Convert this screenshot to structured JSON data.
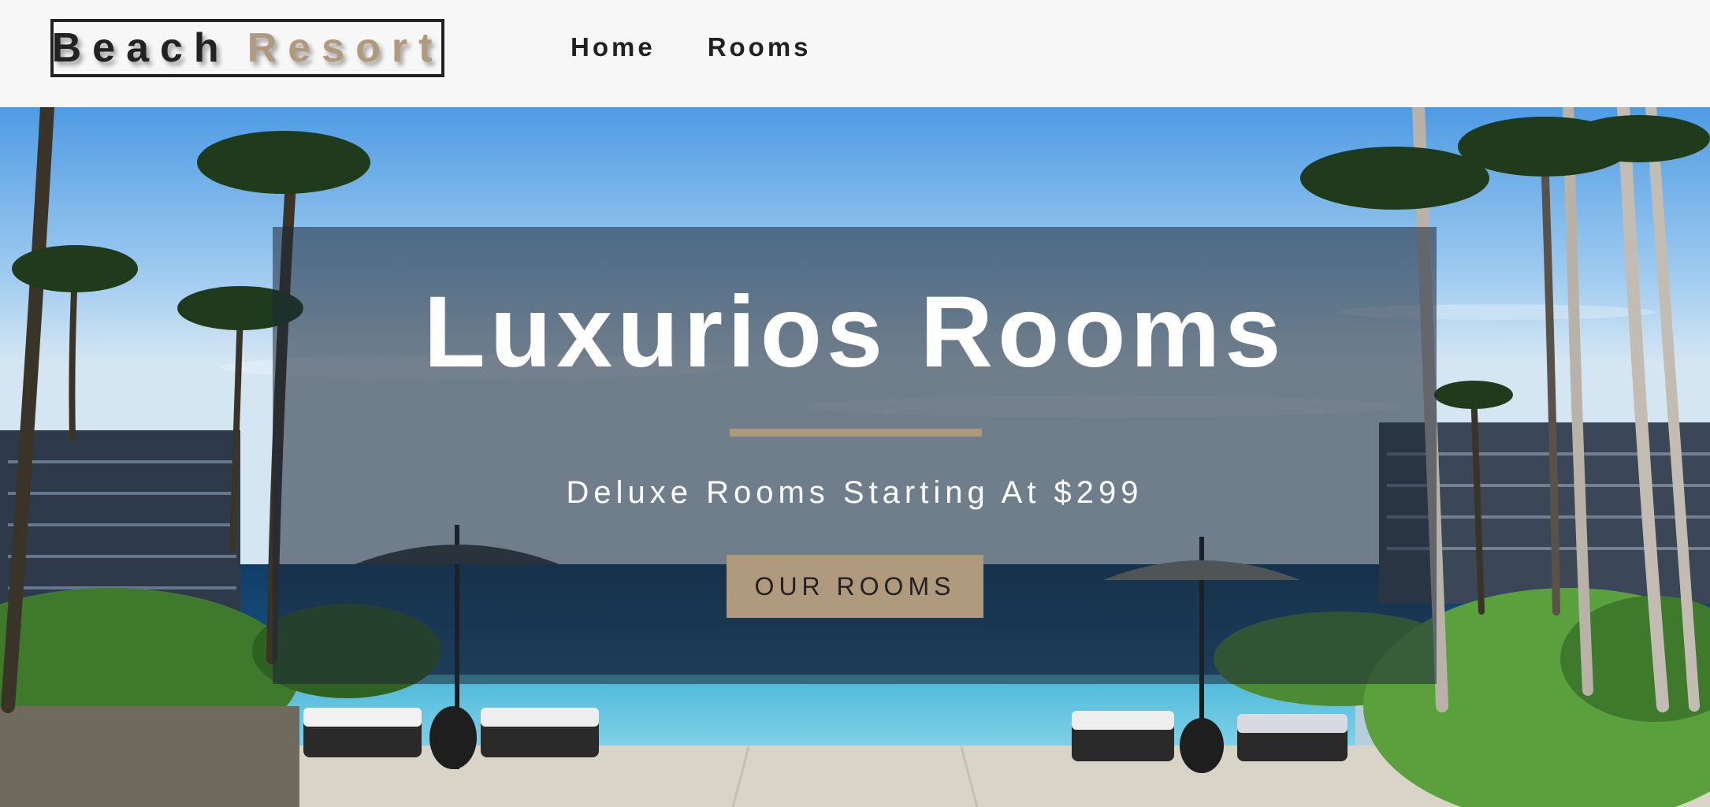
{
  "brand": {
    "word1": "Beach",
    "word2": "Resort",
    "primary_color": "#222222",
    "accent_color": "#af9a7d"
  },
  "nav": {
    "items": [
      {
        "label": "Home"
      },
      {
        "label": "Rooms"
      }
    ]
  },
  "hero": {
    "title": "Luxurios Rooms",
    "subtitle": "Deluxe Rooms Starting At $299",
    "cta_label": "OUR ROOMS",
    "background_image": "resort-pool-ocean-palms-photo"
  }
}
